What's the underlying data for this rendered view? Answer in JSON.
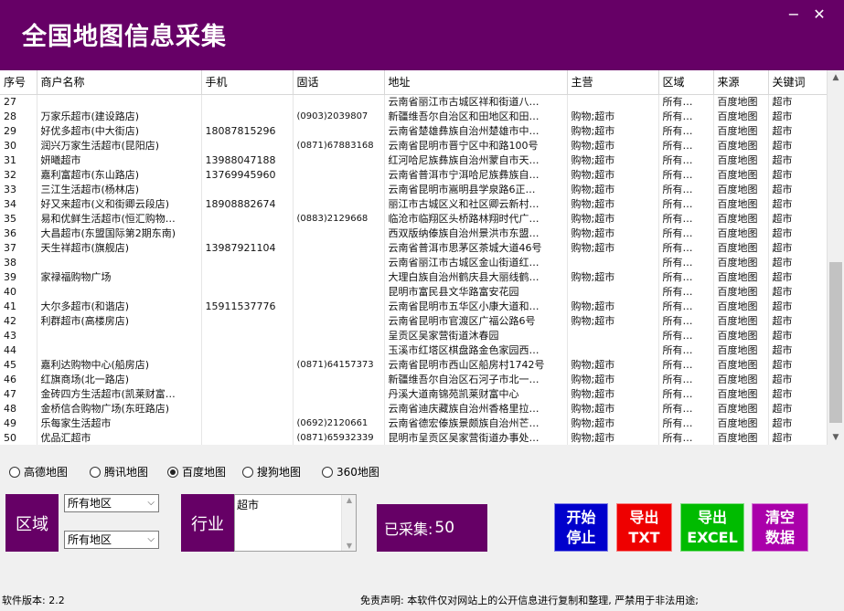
{
  "app": {
    "title": "全国地图信息采集"
  },
  "window": {
    "minimize": "−",
    "close": "✕"
  },
  "table": {
    "columns": [
      "序号",
      "商户名称",
      "手机",
      "固话",
      "地址",
      "主营",
      "区域",
      "来源",
      "关键词"
    ],
    "rows": [
      [
        "27",
        "",
        "",
        "",
        "云南省丽江市古城区祥和街道八…",
        "",
        "所有…",
        "百度地图",
        "超市"
      ],
      [
        "28",
        "万家乐超市(建设路店)",
        "",
        "(0903)2039807",
        "新疆维吾尔自治区和田地区和田…",
        "购物;超市",
        "所有…",
        "百度地图",
        "超市"
      ],
      [
        "29",
        "好优多超市(中大街店)",
        "18087815296",
        "",
        "云南省楚雄彝族自治州楚雄市中…",
        "购物;超市",
        "所有…",
        "百度地图",
        "超市"
      ],
      [
        "30",
        "润兴万家生活超市(昆阳店)",
        "",
        "(0871)67883168",
        "云南省昆明市晋宁区中和路100号",
        "购物;超市",
        "所有…",
        "百度地图",
        "超市"
      ],
      [
        "31",
        "妍曦超市",
        "13988047188",
        "",
        "红河哈尼族彝族自治州蒙自市天…",
        "购物;超市",
        "所有…",
        "百度地图",
        "超市"
      ],
      [
        "32",
        "嘉利富超市(东山路店)",
        "13769945960",
        "",
        "云南省普洱市宁洱哈尼族彝族自…",
        "购物;超市",
        "所有…",
        "百度地图",
        "超市"
      ],
      [
        "33",
        "三江生活超市(杨林店)",
        "",
        "",
        "云南省昆明市嵩明县学泉路6正…",
        "购物;超市",
        "所有…",
        "百度地图",
        "超市"
      ],
      [
        "34",
        "好又来超市(义和街卿云段店)",
        "18908882674",
        "",
        "丽江市古城区义和社区卿云新村…",
        "购物;超市",
        "所有…",
        "百度地图",
        "超市"
      ],
      [
        "35",
        "易和优鲜生活超市(恒汇购物…",
        "",
        "(0883)2129668",
        "临沧市临翔区头桥路林翔时代广…",
        "购物;超市",
        "所有…",
        "百度地图",
        "超市"
      ],
      [
        "36",
        "大昌超市(东盟国际第2期东南)",
        "",
        "",
        "西双版纳傣族自治州景洪市东盟…",
        "购物;超市",
        "所有…",
        "百度地图",
        "超市"
      ],
      [
        "37",
        "天生祥超市(旗舰店)",
        "13987921104",
        "",
        "云南省普洱市思茅区茶城大道46号",
        "购物;超市",
        "所有…",
        "百度地图",
        "超市"
      ],
      [
        "38",
        "",
        "",
        "",
        "云南省丽江市古城区金山街道红…",
        "",
        "所有…",
        "百度地图",
        "超市"
      ],
      [
        "39",
        "家禄福购物广场",
        "",
        "",
        "大理白族自治州鹤庆县大丽线鹤…",
        "购物;超市",
        "所有…",
        "百度地图",
        "超市"
      ],
      [
        "40",
        "",
        "",
        "",
        "昆明市富民县文华路富安花园",
        "",
        "所有…",
        "百度地图",
        "超市"
      ],
      [
        "41",
        "大尔多超市(和谐店)",
        "15911537776",
        "",
        "云南省昆明市五华区小康大道和…",
        "购物;超市",
        "所有…",
        "百度地图",
        "超市"
      ],
      [
        "42",
        "利群超市(高楼房店)",
        "",
        "",
        "云南省昆明市官渡区广福公路6号",
        "购物;超市",
        "所有…",
        "百度地图",
        "超市"
      ],
      [
        "43",
        "",
        "",
        "",
        "呈贡区吴家营街道沐春园",
        "",
        "所有…",
        "百度地图",
        "超市"
      ],
      [
        "44",
        "",
        "",
        "",
        "玉溪市红塔区棋盘路金色家园西…",
        "",
        "所有…",
        "百度地图",
        "超市"
      ],
      [
        "45",
        "嘉利达购物中心(船房店)",
        "",
        "(0871)64157373",
        "云南省昆明市西山区船房村1742号",
        "购物;超市",
        "所有…",
        "百度地图",
        "超市"
      ],
      [
        "46",
        "红旗商场(北一路店)",
        "",
        "",
        "新疆维吾尔自治区石河子市北一…",
        "购物;超市",
        "所有…",
        "百度地图",
        "超市"
      ],
      [
        "47",
        "金砖四方生活超市(凯莱财富…",
        "",
        "",
        "丹溪大道南锦苑凯莱财富中心",
        "购物;超市",
        "所有…",
        "百度地图",
        "超市"
      ],
      [
        "48",
        "金桥信合购物广场(东旺路店)",
        "",
        "",
        "云南省迪庆藏族自治州香格里拉…",
        "购物;超市",
        "所有…",
        "百度地图",
        "超市"
      ],
      [
        "49",
        "乐每家生活超市",
        "",
        "(0692)2120661",
        "云南省德宏傣族景颇族自治州芒…",
        "购物;超市",
        "所有…",
        "百度地图",
        "超市"
      ],
      [
        "50",
        "优品汇超市",
        "",
        "(0871)65932339",
        "昆明市呈贡区吴家营街道办事处…",
        "购物;超市",
        "所有…",
        "百度地图",
        "超市"
      ]
    ]
  },
  "sources": {
    "options": [
      "高德地图",
      "腾讯地图",
      "百度地图",
      "搜狗地图",
      "360地图"
    ],
    "selected": 2
  },
  "region": {
    "label": "区域",
    "province": "所有地区",
    "city": "所有地区"
  },
  "industry": {
    "label": "行业",
    "value": "超市"
  },
  "collected": {
    "label": "已采集:",
    "count": "50"
  },
  "buttons": {
    "start_stop": "开始\n停止",
    "export_txt": "导出\nTXT",
    "export_excel": "导出\nEXCEL",
    "clear": "清空\n数据"
  },
  "colors": {
    "brand": "#660066",
    "start_stop": "#0000cc",
    "export_txt": "#ee0000",
    "export_excel": "#00bb00",
    "clear": "#aa00aa"
  },
  "status": {
    "version": "软件版本: 2.2",
    "disclaimer": "免责声明: 本软件仅对网站上的公开信息进行复制和整理, 严禁用于非法用途;"
  }
}
